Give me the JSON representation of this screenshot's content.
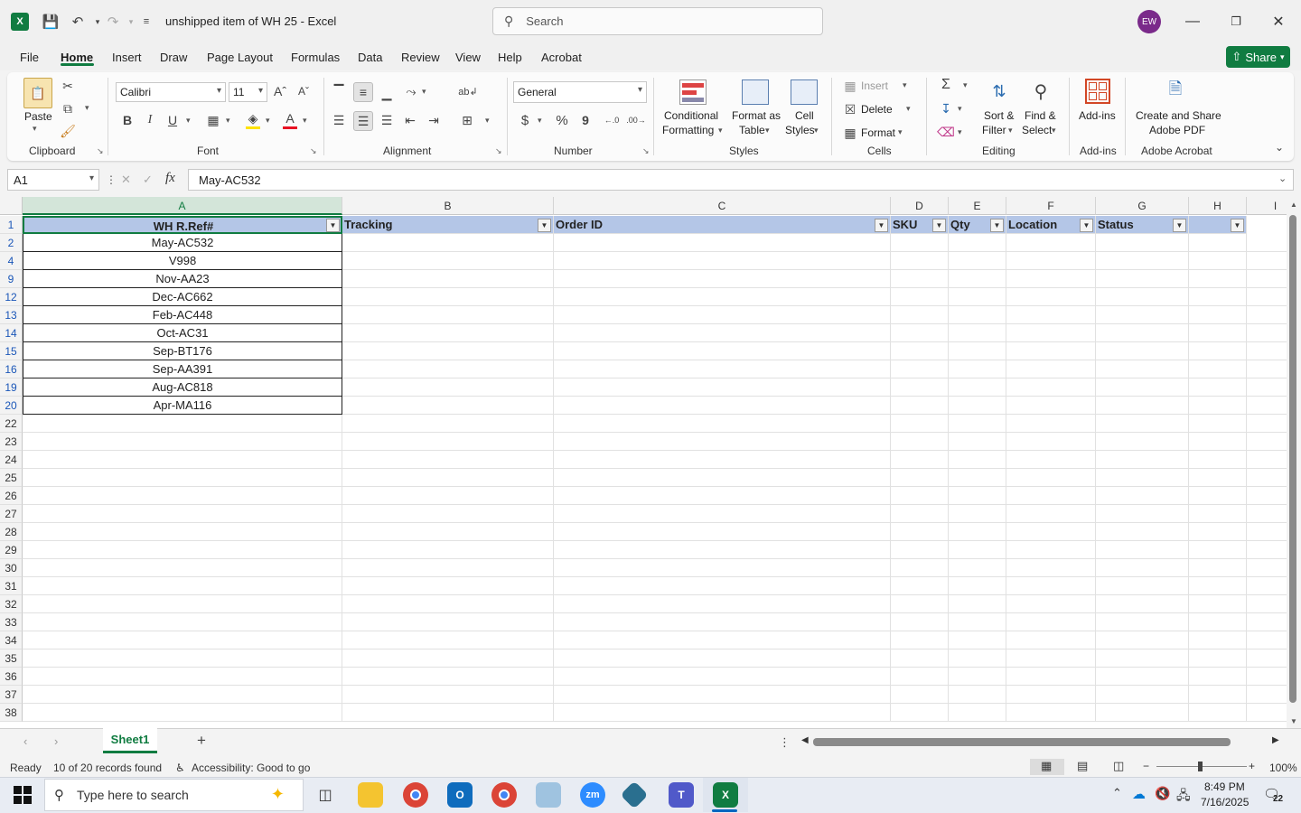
{
  "titlebar": {
    "doc_title": "unshipped item of WH 25  -  Excel",
    "search_placeholder": "Search",
    "avatar_initials": "EW"
  },
  "menu": {
    "tabs": [
      "File",
      "Home",
      "Insert",
      "Draw",
      "Page Layout",
      "Formulas",
      "Data",
      "Review",
      "View",
      "Help",
      "Acrobat"
    ],
    "active": "Home",
    "share_label": "Share"
  },
  "ribbon": {
    "clipboard": {
      "paste": "Paste",
      "label": "Clipboard"
    },
    "font": {
      "family": "Calibri",
      "size": "11",
      "label": "Font",
      "bold": "B",
      "italic": "I",
      "underline": "U"
    },
    "alignment": {
      "label": "Alignment"
    },
    "number": {
      "format": "General",
      "label": "Number",
      "currency": "$",
      "percent": "%",
      "comma": "9"
    },
    "styles": {
      "conditional_1": "Conditional",
      "conditional_2": "Formatting",
      "format_table_1": "Format as",
      "format_table_2": "Table",
      "cell_styles_1": "Cell",
      "cell_styles_2": "Styles",
      "label": "Styles"
    },
    "cells": {
      "insert": "Insert",
      "delete": "Delete",
      "format": "Format",
      "label": "Cells"
    },
    "editing": {
      "sort_1": "Sort &",
      "sort_2": "Filter",
      "find_1": "Find &",
      "find_2": "Select",
      "label": "Editing"
    },
    "addins": {
      "button": "Add-ins",
      "label": "Add-ins"
    },
    "acrobat": {
      "line1": "Create and Share",
      "line2": "Adobe PDF",
      "label": "Adobe Acrobat"
    }
  },
  "formula_bar": {
    "name_box": "A1",
    "fx": "fx",
    "value": "May-AC532"
  },
  "columns": [
    "A",
    "B",
    "C",
    "D",
    "E",
    "F",
    "G",
    "H",
    "I"
  ],
  "headers": {
    "a": "WH R.Ref#",
    "b": "Tracking",
    "c": "Order ID",
    "d": "SKU",
    "e": "Qty",
    "f": "Location",
    "g": "Status"
  },
  "data_rows": [
    {
      "row": "2",
      "value": "May-AC532"
    },
    {
      "row": "4",
      "value": "V998"
    },
    {
      "row": "9",
      "value": "Nov-AA23"
    },
    {
      "row": "12",
      "value": "Dec-AC662"
    },
    {
      "row": "13",
      "value": "Feb-AC448"
    },
    {
      "row": "14",
      "value": "Oct-AC31"
    },
    {
      "row": "15",
      "value": "Sep-BT176"
    },
    {
      "row": "16",
      "value": "Sep-AA391"
    },
    {
      "row": "19",
      "value": "Aug-AC818"
    },
    {
      "row": "20",
      "value": "Apr-MA116"
    }
  ],
  "empty_rows": [
    "22",
    "23",
    "24",
    "25",
    "26",
    "27",
    "28",
    "29",
    "30",
    "31",
    "32",
    "33",
    "34",
    "35",
    "36",
    "37",
    "38"
  ],
  "sheet": {
    "tab": "Sheet1",
    "add": "+"
  },
  "status": {
    "ready": "Ready",
    "records": "10 of 20 records found",
    "accessibility": "Accessibility: Good to go",
    "zoom": "100%"
  },
  "taskbar": {
    "search_placeholder": "Type here to search",
    "time": "8:49 PM",
    "date": "7/16/2025",
    "notifications": "22"
  }
}
